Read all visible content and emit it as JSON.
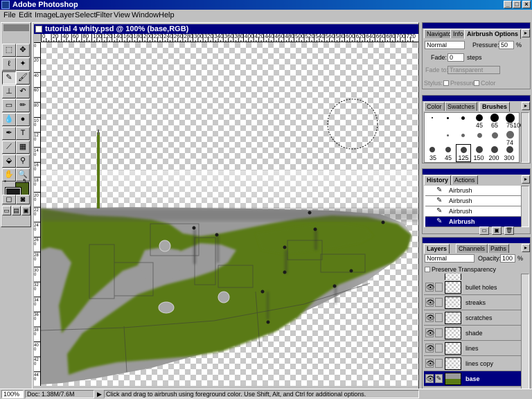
{
  "app": {
    "title": "Adobe Photoshop"
  },
  "window_buttons": [
    "_",
    "□",
    "×"
  ],
  "menu": [
    "File",
    "Edit",
    "Image",
    "Layer",
    "Select",
    "Filter",
    "View",
    "Window",
    "Help"
  ],
  "document": {
    "title": "tutorial 4 whity.psd @ 100% (base,RGB)",
    "ruler_top": [
      "0",
      "20",
      "40",
      "60",
      "80",
      "100",
      "120",
      "140",
      "160",
      "180",
      "200",
      "220",
      "240",
      "260",
      "280",
      "300",
      "320",
      "340",
      "360",
      "380",
      "400",
      "420",
      "440",
      "460",
      "480",
      "500",
      "520",
      "540",
      "560",
      "580",
      "600",
      "620",
      "640",
      "660",
      "680",
      "700",
      "720"
    ],
    "ruler_left": [
      "0",
      "20",
      "40",
      "60",
      "80",
      "100",
      "120",
      "140",
      "160",
      "180",
      "200",
      "220",
      "240",
      "260",
      "280",
      "300",
      "320",
      "340",
      "360",
      "380",
      "400",
      "420",
      "440"
    ]
  },
  "status": {
    "zoom": "100%",
    "doc": "Doc: 1.38M/7.6M",
    "hint": "Click and drag to airbrush using foreground color. Use Shift, Alt, and Ctrl for additional options."
  },
  "colors": {
    "foreground": "#1c1c1c",
    "background": "#4c6418",
    "camo_green": "#5a7a14",
    "camo_gray": "#9a9a9a"
  },
  "options_palette": {
    "tabs": [
      "Navigator",
      "Info",
      "Airbrush Options"
    ],
    "mode": "Normal",
    "pressure_label": "Pressure:",
    "pressure_value": "50",
    "pressure_unit": "%",
    "fade_label": "Fade:",
    "fade_value": "0",
    "fade_unit": "steps",
    "fade_to_label": "Fade to:",
    "fade_to_value": "Transparent",
    "stylus_label": "Stylus:",
    "stylus_pressure": "Pressure",
    "stylus_color": "Color"
  },
  "brushes_palette": {
    "tabs": [
      "Color",
      "Swatches",
      "Brushes"
    ],
    "labels_row1": [
      "",
      "",
      "",
      "45",
      "65",
      "75",
      "100"
    ],
    "labels_row2": [
      "",
      "",
      "",
      "",
      "",
      "",
      "74"
    ],
    "labels_row3": [
      "35",
      "45",
      "125",
      "150",
      "200",
      "300"
    ]
  },
  "history_palette": {
    "tabs": [
      "History",
      "Actions"
    ],
    "items": [
      "Airbrush",
      "Airbrush",
      "Airbrush",
      "Airbrush"
    ]
  },
  "layers_palette": {
    "tabs": [
      "Layers",
      "Channels",
      "Paths"
    ],
    "mode": "Normal",
    "opacity_label": "Opacity:",
    "opacity_value": "100",
    "opacity_unit": "%",
    "preserve_label": "Preserve Transparency",
    "layers": [
      {
        "name": "bullet holes",
        "visible": true
      },
      {
        "name": "streaks",
        "visible": false
      },
      {
        "name": "scratches",
        "visible": true
      },
      {
        "name": "shade",
        "visible": false
      },
      {
        "name": "lines",
        "visible": true
      },
      {
        "name": "lines copy",
        "visible": false
      },
      {
        "name": "base",
        "visible": true,
        "selected": true
      }
    ]
  }
}
